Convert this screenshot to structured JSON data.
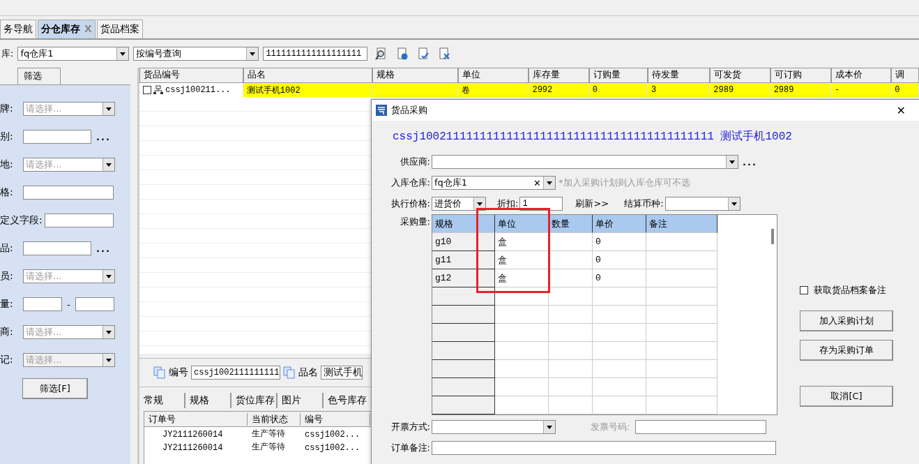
{
  "doc_tabs": [
    {
      "label": "务导航",
      "selected": false
    },
    {
      "label": "分仓库存",
      "selected": true,
      "close": "X"
    },
    {
      "label": "货品档案",
      "selected": false
    }
  ],
  "toolbar": {
    "warehouse_label": "库:",
    "warehouse": "fq仓库1",
    "query_mode": "按编号查询",
    "query_value": "1111111111111111111"
  },
  "filter_panel": {
    "tabs": [
      {
        "label": "筛选"
      }
    ],
    "fields": [
      {
        "kind": "select",
        "label": "牌:",
        "placeholder": "请选择..."
      },
      {
        "kind": "browse",
        "label": "别:",
        "more": "..."
      },
      {
        "kind": "select",
        "label": "地:",
        "placeholder": "请选择..."
      },
      {
        "kind": "text",
        "label": "格:"
      },
      {
        "kind": "text",
        "label": "定义字段:"
      },
      {
        "kind": "browse",
        "label": "品:",
        "more": "..."
      },
      {
        "kind": "select",
        "label": "员:",
        "placeholder": "请选择..."
      },
      {
        "kind": "range",
        "label": "量:",
        "separator": "-"
      },
      {
        "kind": "select",
        "label": "商:",
        "placeholder": "请选择..."
      },
      {
        "kind": "select",
        "label": "记:",
        "placeholder": "请选择...",
        "disabled": true
      }
    ],
    "button": "筛选[F]"
  },
  "stock_table": {
    "columns": [
      "货品编号",
      "品名",
      "规格",
      "单位",
      "库存量",
      "订购量",
      "待发量",
      "可发货",
      "可订购",
      "成本价",
      "调"
    ],
    "rows": [
      {
        "selected": true,
        "checked": false,
        "cells": [
          "cssj100211...",
          "测试手机1002",
          "",
          "卷",
          "2992",
          "0",
          "3",
          "2989",
          "2989",
          "-",
          "0"
        ]
      }
    ]
  },
  "detail_bar": {
    "code_label": "编号",
    "code_value": "cssj1002111111111",
    "name_label": "品名",
    "name_value": "测试手机"
  },
  "detail_tabs": [
    {
      "label": "常规"
    },
    {
      "label": "规格"
    },
    {
      "label": "货位库存"
    },
    {
      "label": "图片"
    },
    {
      "label": "色号库存"
    }
  ],
  "order_table": {
    "columns": [
      "订单号",
      "当前状态",
      "编号"
    ],
    "rows": [
      [
        "JY2111260014",
        "生产等待",
        "cssj1002..."
      ],
      [
        "JY2111260014",
        "生产等待",
        "cssj1002..."
      ]
    ]
  },
  "dialog": {
    "title": "货品采购",
    "close": "✕",
    "product_code": "cssj10021111111111111111111111111111111111111111",
    "product_name": "测试手机1002",
    "supplier_label": "供应商:",
    "supplier_more": "...",
    "warehouse_label": "入库仓库:",
    "warehouse": "fq仓库1",
    "warehouse_clear": "✕",
    "warehouse_hint": "*加入采购计划则入库仓库可不选",
    "price_label": "执行价格:",
    "price": "进货价",
    "discount_label": "折扣:",
    "discount": "1",
    "refresh": "刷新>>",
    "currency_label": "结算币种:",
    "qty_label": "采购量:",
    "grid": {
      "columns": [
        {
          "label": "规格",
          "highlighted": false
        },
        {
          "label": "单位",
          "highlighted": true
        },
        {
          "label": "数量",
          "highlighted": false
        },
        {
          "label": "单价",
          "highlighted": false
        },
        {
          "label": "备注",
          "highlighted": false
        }
      ],
      "rows": [
        [
          "g10",
          "盒",
          "",
          "0",
          ""
        ],
        [
          "g11",
          "盒",
          "",
          "0",
          ""
        ],
        [
          "g12",
          "盒",
          "",
          "0",
          ""
        ]
      ]
    },
    "invoice_label": "开票方式:",
    "invoice_no_label": "发票号码:",
    "remark_label": "订单备注:",
    "fetch_remark": {
      "label": "获取货品档案备注",
      "checked": false
    },
    "buttons": [
      "加入采购计划",
      "存为采购订单",
      "取消[C]"
    ]
  }
}
